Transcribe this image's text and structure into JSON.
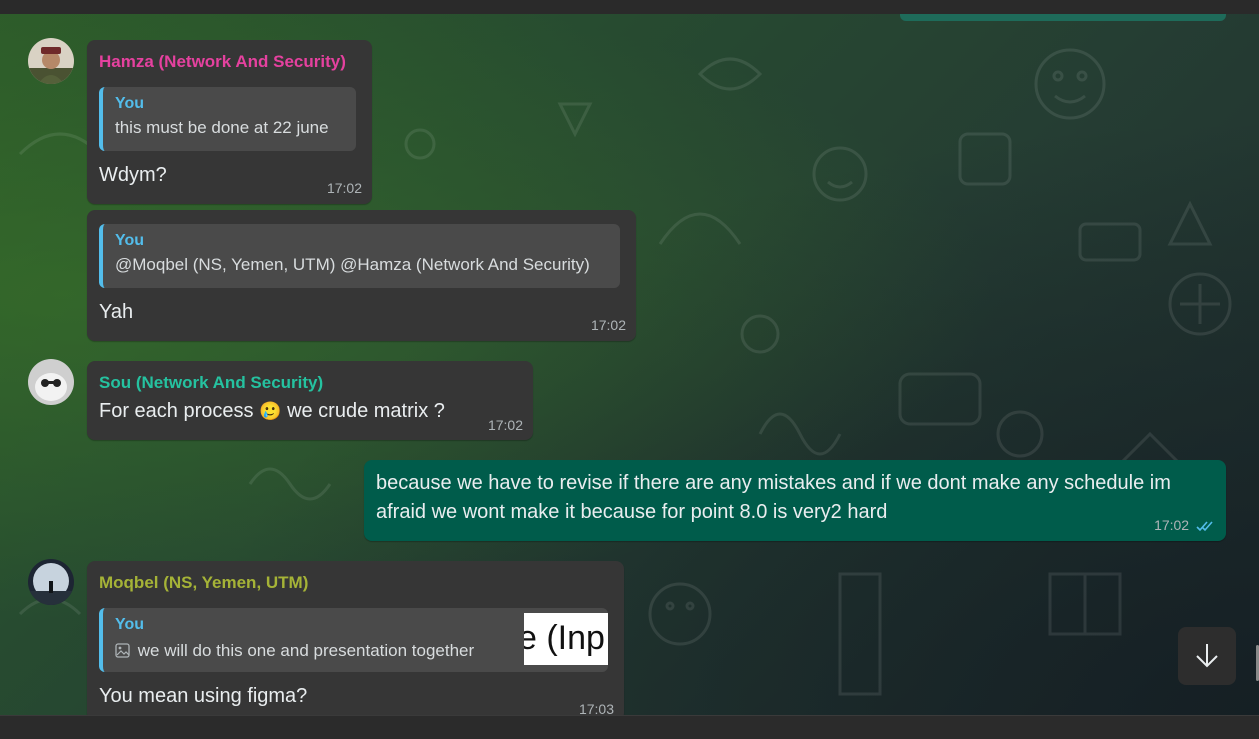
{
  "messages": [
    {
      "sender": "Hamza (Network And Security)",
      "sender_color": "#e5419f",
      "quote": {
        "author": "You",
        "text": "this must be done at 22 june"
      },
      "text": "Wdym?",
      "time": "17:02"
    },
    {
      "quote": {
        "author": "You",
        "text": "@Moqbel (NS, Yemen, UTM) @Hamza (Network And Security)"
      },
      "text": "Yah",
      "time": "17:02"
    },
    {
      "sender": "Sou (Network And Security)",
      "sender_color": "#25c2a0",
      "text_before": "For each process",
      "emoji": "🥲",
      "text_after": "we crude  matrix ?",
      "time": "17:02"
    },
    {
      "outgoing": true,
      "line1": "because we have to revise if there are any mistakes and if we dont make any schedule im",
      "line2": "afraid we wont make it because for point 8.0 is very2 hard",
      "time": "17:02",
      "status": "read-double-check-icon"
    },
    {
      "sender": "Moqbel (NS, Yemen, UTM)",
      "sender_color": "#a5b337",
      "quote": {
        "author": "You",
        "text": "we will do this one and presentation together",
        "thumbnail_text": "e (Inp"
      },
      "text": "You mean using figma?",
      "time": "17:03"
    }
  ],
  "scroll_button_icon": "arrow-down-icon"
}
